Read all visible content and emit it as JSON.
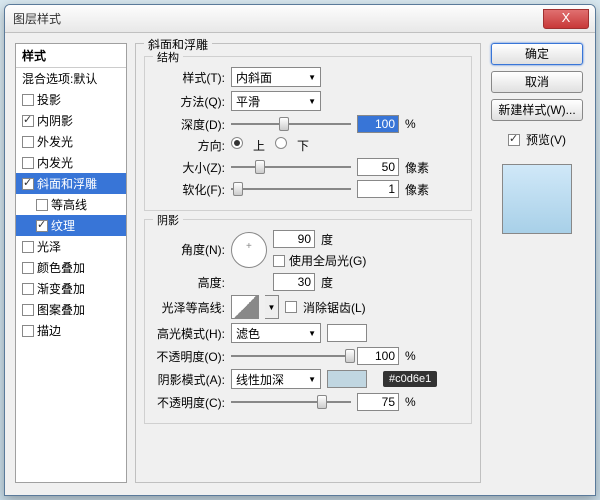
{
  "window": {
    "title": "图层样式",
    "close": "X"
  },
  "styleList": {
    "header": "样式",
    "blend": "混合选项:默认",
    "items": [
      {
        "label": "投影",
        "checked": false
      },
      {
        "label": "内阴影",
        "checked": true
      },
      {
        "label": "外发光",
        "checked": false
      },
      {
        "label": "内发光",
        "checked": false
      },
      {
        "label": "斜面和浮雕",
        "checked": true,
        "selected": true
      },
      {
        "label": "等高线",
        "checked": false,
        "sub": true
      },
      {
        "label": "纹理",
        "checked": true,
        "sub": true,
        "selected": true
      },
      {
        "label": "光泽",
        "checked": false
      },
      {
        "label": "颜色叠加",
        "checked": false
      },
      {
        "label": "渐变叠加",
        "checked": false
      },
      {
        "label": "图案叠加",
        "checked": false
      },
      {
        "label": "描边",
        "checked": false
      }
    ]
  },
  "bevel": {
    "title": "斜面和浮雕",
    "structure": {
      "title": "结构",
      "styleLbl": "样式(T):",
      "styleVal": "内斜面",
      "techLbl": "方法(Q):",
      "techVal": "平滑",
      "depthLbl": "深度(D):",
      "depthVal": "100",
      "depthUnit": "%",
      "dirLbl": "方向:",
      "up": "上",
      "down": "下",
      "sizeLbl": "大小(Z):",
      "sizeVal": "50",
      "sizeUnit": "像素",
      "softLbl": "软化(F):",
      "softVal": "1",
      "softUnit": "像素"
    },
    "shading": {
      "title": "阴影",
      "angleLbl": "角度(N):",
      "angleVal": "90",
      "angleUnit": "度",
      "globalLbl": "使用全局光(G)",
      "altLbl": "高度:",
      "altVal": "30",
      "altUnit": "度",
      "glossLbl": "光泽等高线:",
      "antiLbl": "消除锯齿(L)",
      "hiLbl": "高光模式(H):",
      "hiVal": "滤色",
      "hiOpLbl": "不透明度(O):",
      "hiOpVal": "100",
      "hiOpUnit": "%",
      "shLbl": "阴影模式(A):",
      "shVal": "线性加深",
      "shOpLbl": "不透明度(C):",
      "shOpVal": "75",
      "shOpUnit": "%"
    }
  },
  "right": {
    "ok": "确定",
    "cancel": "取消",
    "newStyle": "新建样式(W)...",
    "previewLbl": "预览(V)"
  },
  "tooltip": "#c0d6e1"
}
